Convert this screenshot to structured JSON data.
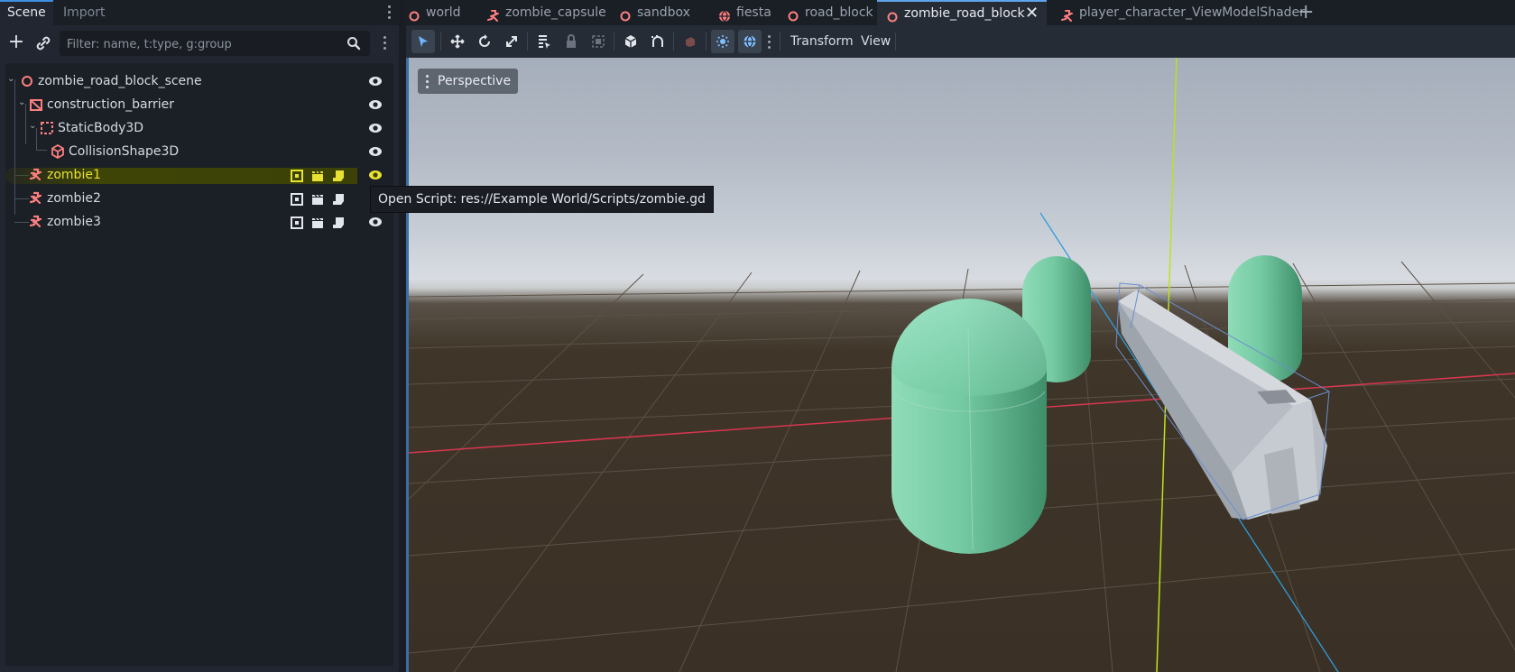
{
  "dock": {
    "tabs": [
      "Scene",
      "Import"
    ],
    "filter_placeholder": "Filter: name, t:type, g:group"
  },
  "tree": {
    "nodes": [
      {
        "label": "zombie_road_block_scene",
        "icon": "scene-root-icon"
      },
      {
        "label": "construction_barrier",
        "icon": "node3d-icon"
      },
      {
        "label": "StaticBody3D",
        "icon": "static-body-icon"
      },
      {
        "label": "CollisionShape3D",
        "icon": "collision-shape-icon"
      },
      {
        "label": "zombie1",
        "icon": "zombie-instance-icon",
        "selected": true
      },
      {
        "label": "zombie2",
        "icon": "zombie-instance-icon"
      },
      {
        "label": "zombie3",
        "icon": "zombie-instance-icon"
      }
    ],
    "tooltip": "Open Script: res://Example World/Scripts/zombie.gd"
  },
  "scene_tabs": [
    {
      "label": "world",
      "icon": "scene-circle-icon"
    },
    {
      "label": "zombie_capsule",
      "icon": "zombie-instance-icon"
    },
    {
      "label": "sandbox",
      "icon": "scene-circle-icon"
    },
    {
      "label": "fiesta",
      "icon": "globe-icon"
    },
    {
      "label": "road_block",
      "icon": "scene-circle-icon"
    },
    {
      "label": "zombie_road_block",
      "icon": "scene-circle-icon",
      "active": true
    },
    {
      "label": "player_character_ViewModelShader",
      "icon": "zombie-instance-icon"
    }
  ],
  "toolbar": {
    "transform_label": "Transform",
    "view_label": "View"
  },
  "viewport": {
    "perspective_label": "Perspective"
  },
  "colors": {
    "accent": "#5fa3ea",
    "node_red": "#fc7f7f",
    "selected_yellow": "#e8e233",
    "capsule_green": "#6fcfa3"
  }
}
